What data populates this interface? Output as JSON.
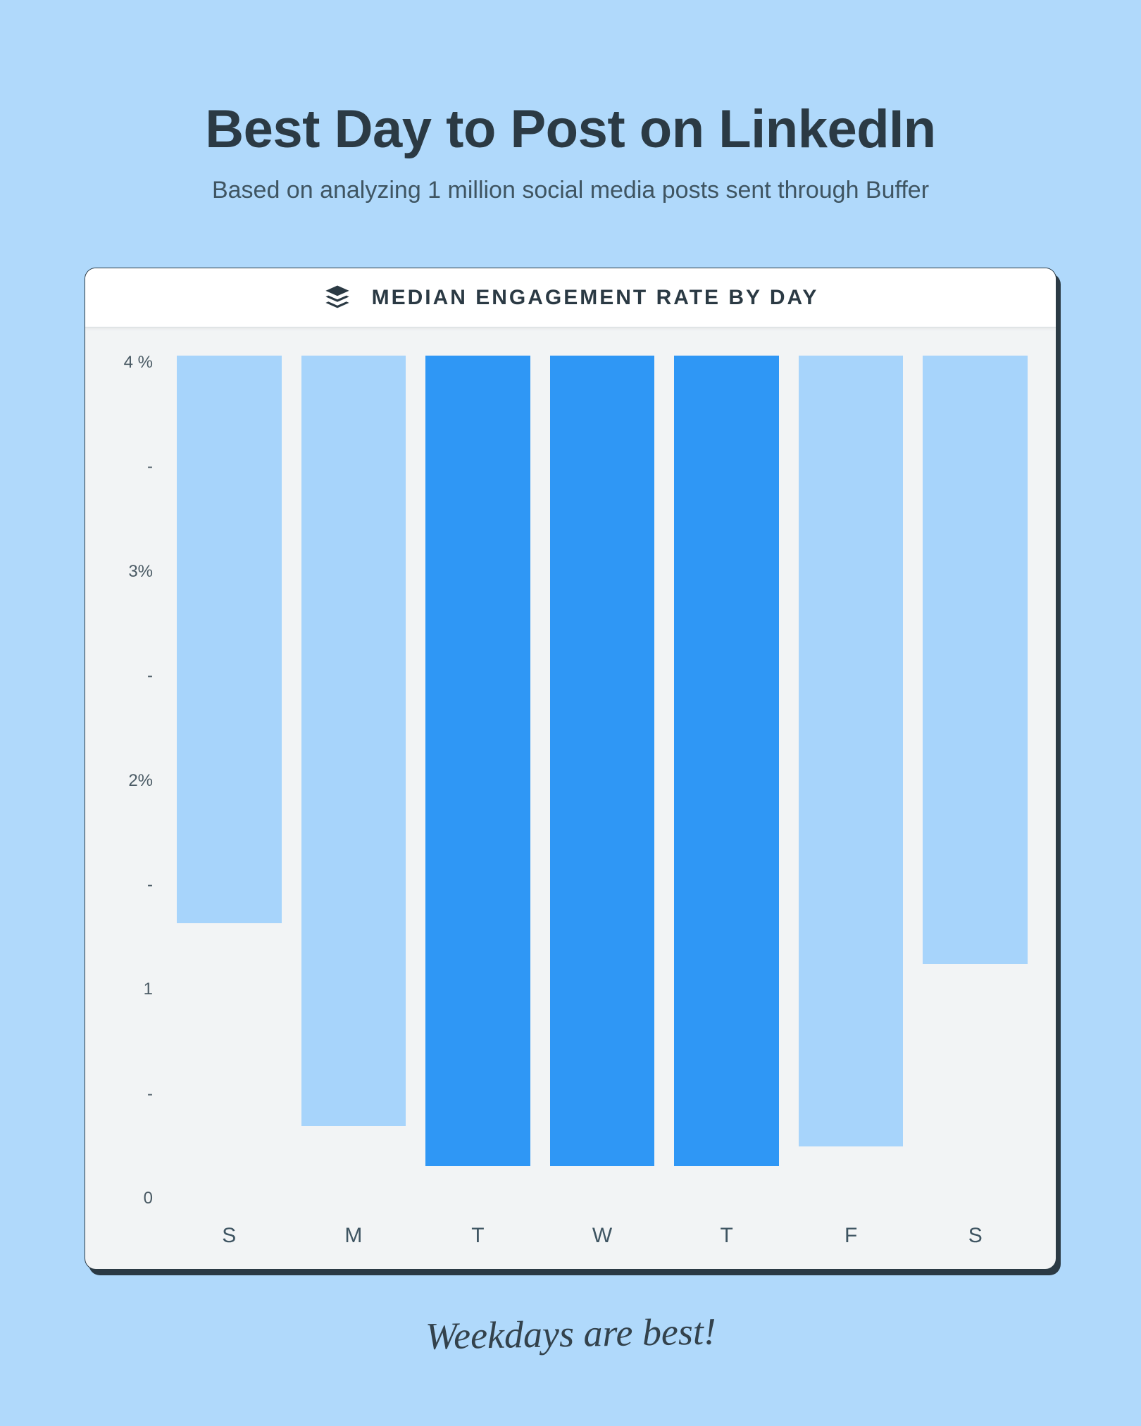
{
  "title": "Best Day to Post on LinkedIn",
  "subtitle": "Based on analyzing 1 million social media posts sent through Buffer",
  "panel_title": "MEDIAN ENGAGEMENT RATE BY DAY",
  "caption": "Weekdays are best!",
  "y_ticks": [
    "4 %",
    "-",
    "3%",
    "-",
    "2%",
    "-",
    "1",
    "-",
    "0"
  ],
  "chart_data": {
    "type": "bar",
    "title": "MEDIAN ENGAGEMENT RATE BY DAY",
    "xlabel": "",
    "ylabel": "Median engagement rate",
    "ylim": [
      0,
      4.2
    ],
    "categories": [
      "S",
      "M",
      "T",
      "W",
      "T",
      "F",
      "S"
    ],
    "values": [
      2.8,
      3.8,
      4.0,
      4.0,
      4.0,
      3.9,
      3.0
    ],
    "highlight": [
      false,
      false,
      true,
      true,
      true,
      false,
      false
    ],
    "colors": {
      "normal": "#a7d4fb",
      "highlight": "#2f97f5",
      "bg": "#b0d9fb"
    }
  }
}
